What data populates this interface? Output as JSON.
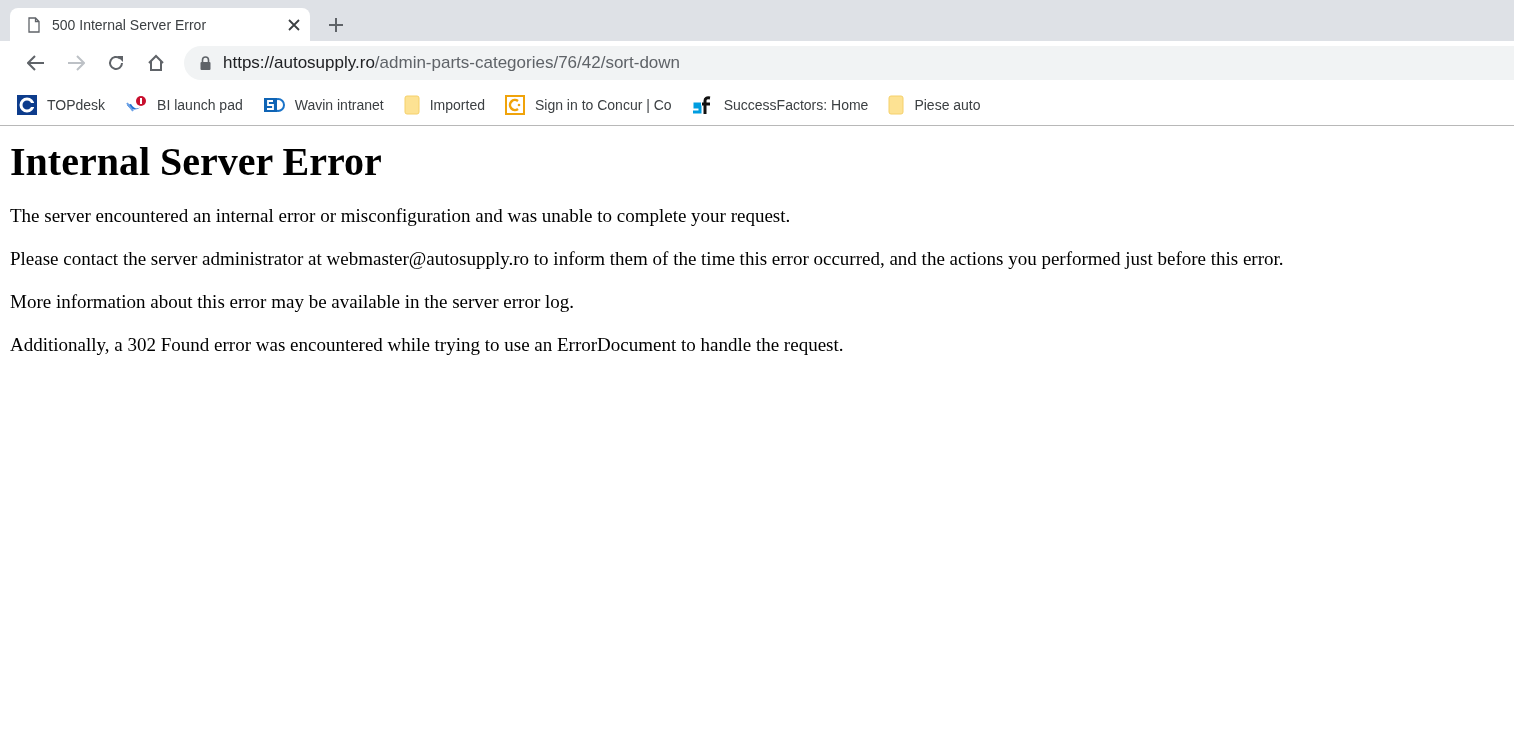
{
  "tab": {
    "title": "500 Internal Server Error",
    "selected": true
  },
  "toolbar": {
    "forward_disabled": true,
    "url_host": "https://autosupply.ro",
    "url_path": "/admin-parts-categories/76/42/sort-down"
  },
  "bookmarks": [
    {
      "kind": "topdesk",
      "label": "TOPdesk"
    },
    {
      "kind": "bi",
      "label": "BI launch pad"
    },
    {
      "kind": "sharepoint",
      "label": "Wavin intranet"
    },
    {
      "kind": "folder",
      "label": "Imported"
    },
    {
      "kind": "concur",
      "label": "Sign in to Concur | Co"
    },
    {
      "kind": "sf",
      "label": "SuccessFactors: Home"
    },
    {
      "kind": "folder",
      "label": "Piese auto"
    }
  ],
  "page": {
    "heading": "Internal Server Error",
    "paragraphs": [
      "The server encountered an internal error or misconfiguration and was unable to complete your request.",
      "Please contact the server administrator at webmaster@autosupply.ro to inform them of the time this error occurred, and the actions you performed just before this error.",
      "More information about this error may be available in the server error log.",
      "Additionally, a 302 Found error was encountered while trying to use an ErrorDocument to handle the request."
    ]
  }
}
